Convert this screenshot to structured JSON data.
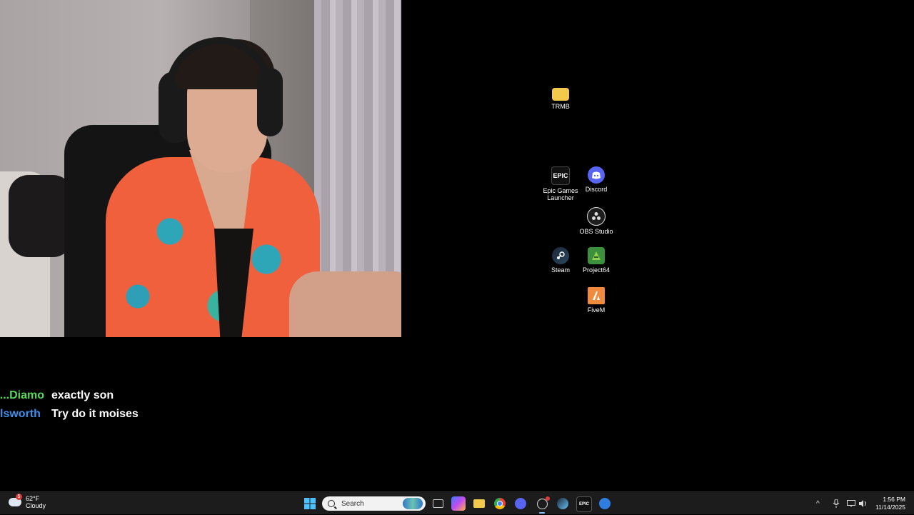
{
  "chat": {
    "messages": [
      {
        "user": "Diamo...",
        "text": "exactly son",
        "color": "#58d95a"
      },
      {
        "user": "lsworth",
        "text": "Try do it moises",
        "color": "#3e8eea"
      }
    ]
  },
  "desktop": {
    "icons": {
      "trmb": "TRMB",
      "epic": "Epic Games Launcher",
      "discord": "Discord",
      "obs": "OBS Studio",
      "steam": "Steam",
      "project64": "Project64",
      "fivem": "FiveM"
    }
  },
  "taskbar": {
    "weather": {
      "temp": "62°F",
      "condition": "Cloudy",
      "badge": "5"
    },
    "search_placeholder": "Search",
    "apps": [
      "start",
      "search",
      "task-view",
      "copilot",
      "file-explorer",
      "chrome",
      "discord",
      "obs-studio",
      "steam",
      "epic-games",
      "other"
    ],
    "clock": {
      "time": "1:56 PM",
      "date": "11/14/2025"
    }
  },
  "colors": {
    "taskbar_bg": "#1c1c1c",
    "desktop_bg": "#000000"
  }
}
